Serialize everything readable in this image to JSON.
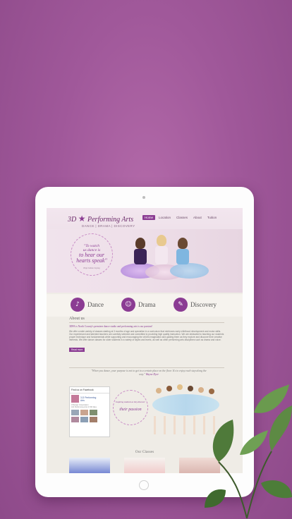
{
  "site": {
    "logo_part1": "3D",
    "logo_part2": "Performing Arts",
    "tagline": "DANCE | DRAMA | DISCOVERY"
  },
  "nav": {
    "items": [
      "Home",
      "Location",
      "Classes",
      "About",
      "Tuition"
    ]
  },
  "hero": {
    "quote_line1": "\"To watch",
    "quote_line2": "us dance is",
    "quote_big1": "to hear our",
    "quote_big2": "hearts speak\"",
    "quote_author": "Hopi Indian Saying"
  },
  "disciplines": {
    "dance": "Dance",
    "drama": "Drama",
    "discovery": "Discovery"
  },
  "about": {
    "title": "About us",
    "lead": "3DPA is North County's premiere dance studio and performing arts is our passion!",
    "body": "We offer a wide variety of classes starting at 3 months of age and specialize in a curriculum that reinforces early childhood development and motor skills. Our experienced and talented teachers are carefully selected and committed to providing high quality instruction. We are dedicated to teaching our students proper technique and fundamentals while supporting and encouraging the child's imagination and guiding them as they explore and discover their creative interests. We offer dance classes for older students in a variety of styles and levels, as well as other performing arts disciplines such as drama and voice.",
    "read_more": "Read more"
  },
  "quote2": {
    "text": "\"When you dance, your purpose is not to get to a certain place on the floor. It's to enjoy each step along the way.\"",
    "author": "Wayne Dyer"
  },
  "facebook": {
    "header": "Find us on Facebook",
    "page_name_line1": "3-D Performing",
    "page_name_line2": "Arts",
    "like_text": "3 Design Corporation",
    "people_text": "3-D Performing Arts 3,700 likes"
  },
  "badge": {
    "small": "Inspiring students as they discover",
    "big": "their passion"
  },
  "classes": {
    "title": "Our Classes"
  },
  "colors": {
    "accent": "#8b3c93",
    "background": "#a0589a"
  }
}
